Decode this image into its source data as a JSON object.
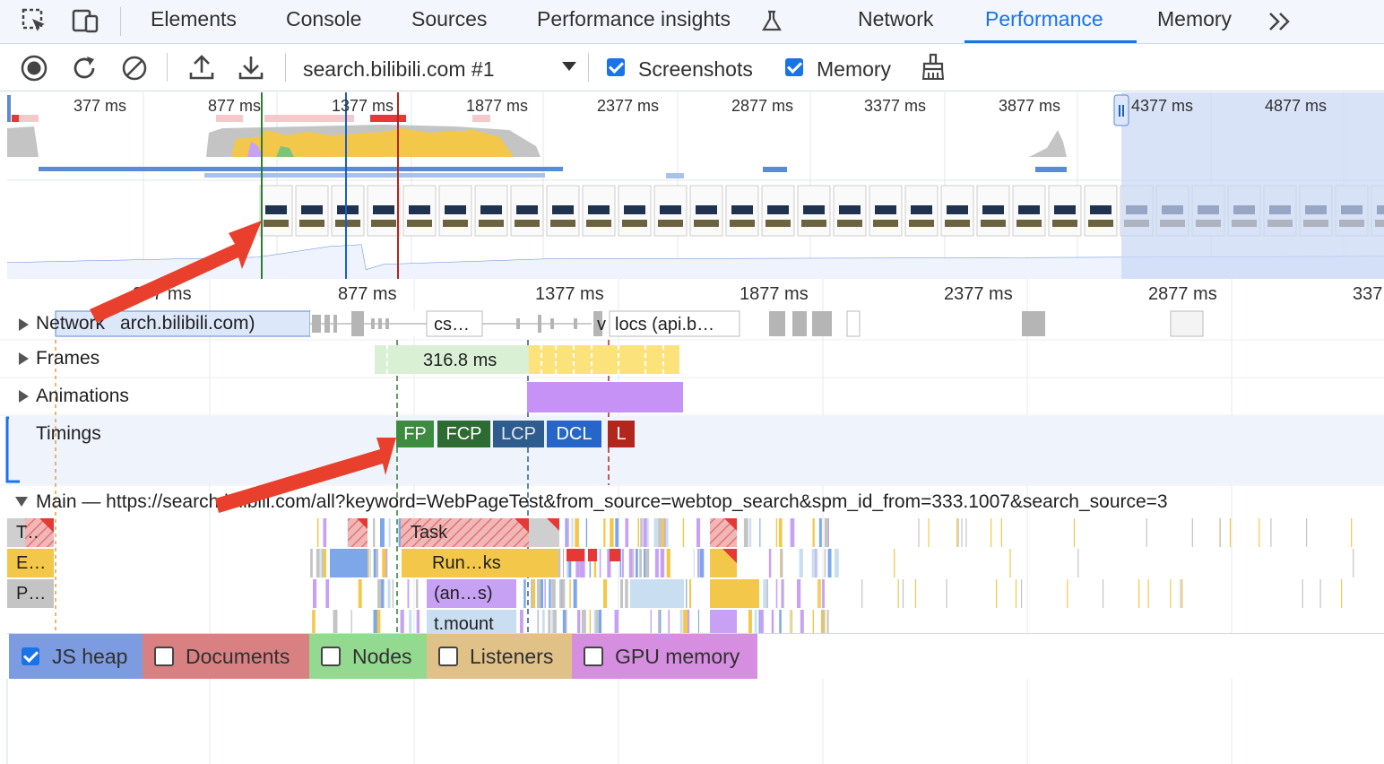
{
  "tabs": [
    {
      "label": "Elements"
    },
    {
      "label": "Console"
    },
    {
      "label": "Sources"
    },
    {
      "label": "Performance insights"
    },
    {
      "label": "Network"
    },
    {
      "label": "Performance"
    },
    {
      "label": "Memory"
    }
  ],
  "active_tab": "Performance",
  "toolbar": {
    "recording_select": "search.bilibili.com #1",
    "screenshots_label": "Screenshots",
    "screenshots_checked": true,
    "memory_label": "Memory",
    "memory_checked": true
  },
  "overview": {
    "ticks": [
      "377 ms",
      "877 ms",
      "1377 ms",
      "1877 ms",
      "2377 ms",
      "2877 ms",
      "3377 ms",
      "3877 ms",
      "4377 ms",
      "4877 ms"
    ]
  },
  "ruler": {
    "ticks": [
      "377 ms",
      "877 ms",
      "1377 ms",
      "1877 ms",
      "2377 ms",
      "2877 ms",
      "337"
    ]
  },
  "tracks": {
    "network": {
      "label": "Network",
      "req1": "arch.bilibili.com)",
      "req2": "cs…",
      "req3": "v",
      "req4": "locs (api.b…"
    },
    "frames": {
      "label": "Frames",
      "frame_duration": "316.8 ms"
    },
    "animations": {
      "label": "Animations"
    },
    "timings": {
      "label": "Timings",
      "marks": [
        "FP",
        "FCP",
        "LCP",
        "DCL",
        "L"
      ]
    },
    "main": {
      "label": "Main — https://search.bilibili.com/all?keyword=WebPageTest&from_source=webtop_search&spm_id_from=333.1007&search_source=3",
      "row_labels": [
        "T…",
        "E…",
        "P…"
      ],
      "task": "Task",
      "run": "Run…ks",
      "anon": "(an…s)",
      "mount": "t.mount"
    }
  },
  "counters": [
    {
      "label": "JS heap",
      "checked": true,
      "color": "#7d9be0"
    },
    {
      "label": "Documents",
      "checked": false,
      "color": "#d98182"
    },
    {
      "label": "Nodes",
      "checked": false,
      "color": "#93d98f"
    },
    {
      "label": "Listeners",
      "checked": false,
      "color": "#e0c188"
    },
    {
      "label": "GPU memory",
      "checked": false,
      "color": "#d68ee0"
    }
  ],
  "colors": {
    "accent": "#1a73e8",
    "fp": "#3d8b41",
    "fcp": "#2e6b33",
    "lcp": "#2f5c8d",
    "dcl": "#2766c8",
    "load": "#b3261e",
    "scripting": "#f3c74a",
    "rendering": "#c7a2f4",
    "painting": "#7bc47e"
  }
}
